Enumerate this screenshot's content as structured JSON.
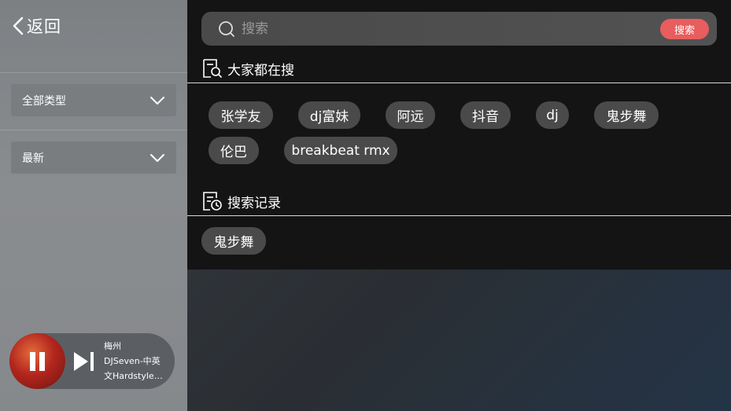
{
  "nav": {
    "back_label": "返回"
  },
  "filters": {
    "type_label": "全部类型",
    "sort_label": "最新"
  },
  "player": {
    "title": "梅州",
    "artist": "DJSeven-中英",
    "subtitle": "文Hardstyle…"
  },
  "search": {
    "placeholder": "搜索",
    "button_label": "搜索"
  },
  "hot": {
    "heading": "大家都在搜",
    "tags": [
      "张学友",
      "dj富妹",
      "阿远",
      "抖音",
      "dj",
      "鬼步舞",
      "伦巴",
      "breakbeat rmx"
    ]
  },
  "history": {
    "heading": "搜索记录",
    "tags": [
      "鬼步舞"
    ]
  },
  "colors": {
    "accent": "#e85d5d",
    "tag_bg": "#4a4a4a",
    "panel_bg": "#141414"
  }
}
